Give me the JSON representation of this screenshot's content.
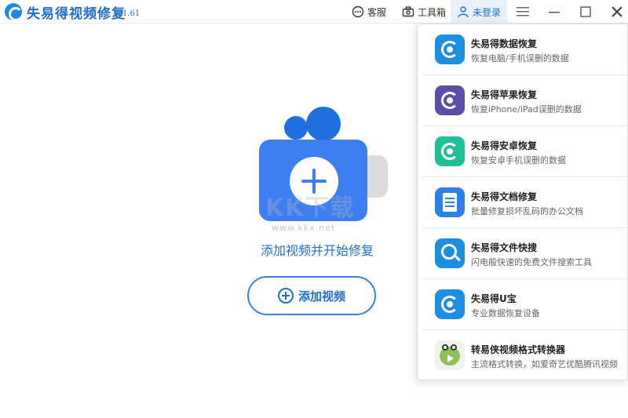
{
  "titlebar": {
    "title": "失易得视频修复",
    "version": "1.61",
    "service_label": "客服",
    "toolbox_label": "工具箱",
    "user_label": "未登录"
  },
  "main": {
    "watermark_text": "KK下载",
    "watermark_url": "www.kkx.net",
    "caption": "添加视频并开始修复",
    "add_button_label": "添加视频"
  },
  "toolbox_menu": {
    "items": [
      {
        "title": "失易得数据恢复",
        "desc": "恢复电脑/手机误删的数据",
        "icon": "data-recovery-icon"
      },
      {
        "title": "失易得苹果恢复",
        "desc": "恢复iPhone/iPad误删的数据",
        "icon": "apple-recovery-icon"
      },
      {
        "title": "失易得安卓恢复",
        "desc": "恢复安卓手机误删的数据",
        "icon": "android-recovery-icon"
      },
      {
        "title": "失易得文档修复",
        "desc": "批量修复损坏乱码的办公文档",
        "icon": "document-repair-icon"
      },
      {
        "title": "失易得文件快搜",
        "desc": "闪电般快速的免费文件搜索工具",
        "icon": "file-search-icon"
      },
      {
        "title": "失易得U宝",
        "desc": "专业数据恢复设备",
        "icon": "ubao-icon"
      },
      {
        "title": "转易侠视频格式转换器",
        "desc": "主流格式转换，如爱奇艺优酷腾讯视频",
        "icon": "video-converter-icon"
      }
    ]
  },
  "colors": {
    "brand_blue": "#1e6fd0",
    "camera_blue": "#3d7ff0",
    "user_highlight": "#e7f0fb"
  }
}
